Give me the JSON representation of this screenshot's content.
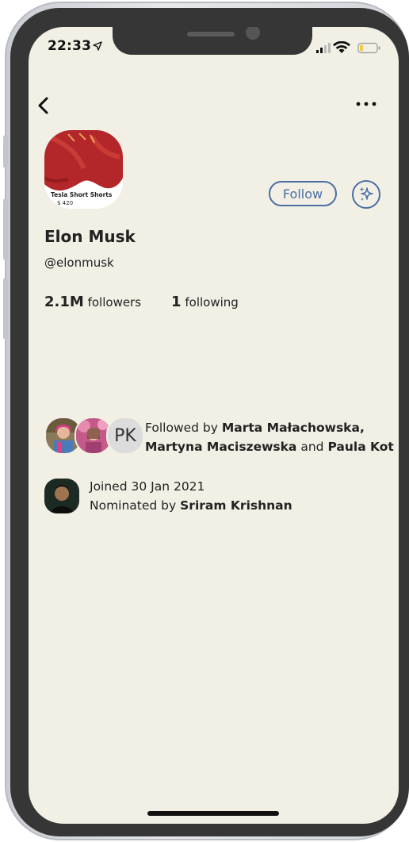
{
  "status_bar": {
    "time": "22:33"
  },
  "profile": {
    "photo_caption": "Tesla Short Shorts",
    "photo_price": "$ 420",
    "name": "Elon Musk",
    "handle": "@elonmusk",
    "followers_count": "2.1M",
    "followers_label": "followers",
    "following_count": "1",
    "following_label": "following"
  },
  "actions": {
    "follow_label": "Follow"
  },
  "followed_by": {
    "prefix": "Followed by",
    "name1": "Marta Małachowska,",
    "name2": "Martyna Maciszewska",
    "conj": "and",
    "name3": "Paula Kot",
    "initials": "PK"
  },
  "joined": {
    "text": "Joined 30 Jan 2021",
    "nominated_prefix": "Nominated by",
    "nominator": "Sriram Krishnan"
  },
  "colors": {
    "accent": "#4a6fa5",
    "background": "#f2efe5",
    "bezel": "#363636"
  }
}
